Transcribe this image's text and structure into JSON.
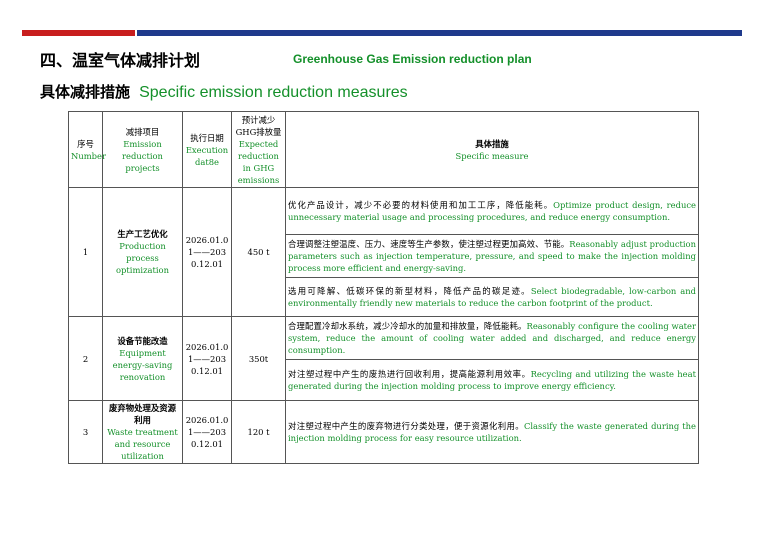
{
  "header": {
    "title_cn": "四、温室气体减排计划",
    "title_en": "Greenhouse Gas Emission reduction plan",
    "subtitle_cn": "具体减排措施",
    "subtitle_en": "Specific emission reduction measures"
  },
  "table": {
    "headers": {
      "no_cn": "序号",
      "no_en": "Number",
      "project_cn": "减排项目",
      "project_en": "Emission reduction projects",
      "date_cn": "执行日期",
      "date_en": "Execution dat8e",
      "reduction_cn": "预计减少GHG排放量",
      "reduction_en": "Expected reduction in GHG emissions",
      "measure_cn": "具体措施",
      "measure_en": "Specific measure"
    },
    "rows": [
      {
        "no": "1",
        "project_cn": "生产工艺优化",
        "project_en": "Production process optimization",
        "date": "2026.01.01——2030.12.01",
        "reduction": "450 t",
        "measures": [
          {
            "cn": "优化产品设计，减少不必要的材料使用和加工工序，降低能耗。",
            "en": "Optimize product design, reduce unnecessary material usage and processing procedures, and reduce energy consumption."
          },
          {
            "cn": "合理调整注塑温度、压力、速度等生产参数，使注塑过程更加高效、节能。",
            "en": "Reasonably adjust production parameters such as injection temperature, pressure, and speed to make the injection molding process more efficient and energy-saving."
          },
          {
            "cn": "选用可降解、低碳环保的新型材料，降低产品的碳足迹。",
            "en": "Select biodegradable, low-carbon and environmentally friendly new materials to reduce the carbon footprint of the product."
          }
        ]
      },
      {
        "no": "2",
        "project_cn": "设备节能改造",
        "project_en": "Equipment energy-saving renovation",
        "date": "2026.01.01——2030.12.01",
        "reduction": "350t",
        "measures": [
          {
            "cn": "合理配置冷却水系统，减少冷却水的加量和排放量，降低能耗。",
            "en": "Reasonably configure the cooling water system, reduce the amount of cooling water added and discharged, and reduce energy consumption."
          },
          {
            "cn": "对注塑过程中产生的废热进行回收利用，提高能源利用效率。",
            "en": "Recycling and utilizing the waste heat generated during the injection molding process to improve energy efficiency."
          }
        ]
      },
      {
        "no": "3",
        "project_cn": "废弃物处理及资源利用",
        "project_en": "Waste treatment and resource utilization",
        "date": "2026.01.01——2030.12.01",
        "reduction": "120 t",
        "measures": [
          {
            "cn": "对注塑过程中产生的废弃物进行分类处理，便于资源化利用。",
            "en": "Classify the waste generated during the injection molding process for easy resource utilization."
          }
        ]
      }
    ]
  },
  "colors": {
    "accent_green": "#14902a",
    "bar_red": "#c81e1e",
    "bar_blue": "#1f3a8c"
  }
}
